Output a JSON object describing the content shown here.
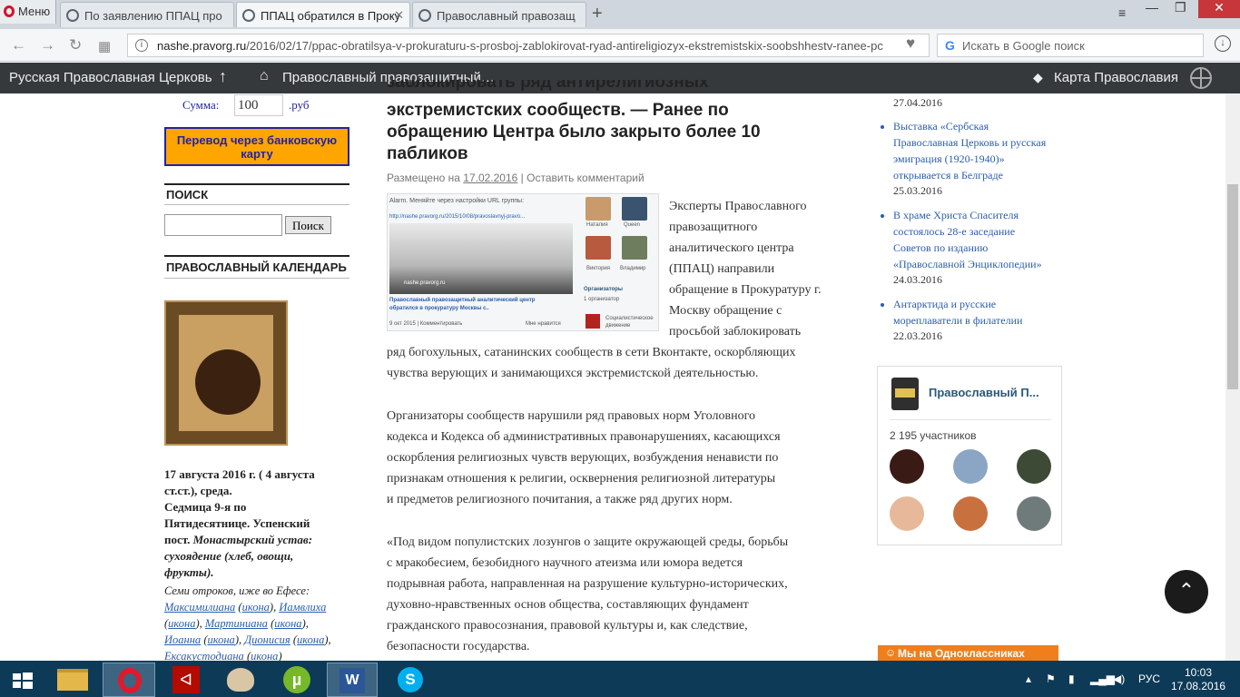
{
  "browser": {
    "menu_label": "Меню",
    "tabs": [
      {
        "title": "По заявлению ППАЦ про",
        "active": false
      },
      {
        "title": "ППАЦ обратился в Проку",
        "active": true
      },
      {
        "title": "Православный правозащ",
        "active": false
      }
    ],
    "url_host": "nashe.pravorg.ru",
    "url_path": "/2016/02/17/ppac-obratilsya-v-prokuraturu-s-prosboj-zablokirovat-ryad-antireligiozyx-ekstremistskix-soobshhestv-ranee-pc",
    "search_placeholder": "Искать в Google поиск"
  },
  "wp_bar": {
    "site1": "Русская Православная Церковь",
    "site2": "Православный правозащитный…",
    "map": "Карта Православия"
  },
  "left": {
    "sum_label": "Сумма:",
    "sum_value": "100",
    "currency": ".руб",
    "donate_button": "Перевод через банковскую карту",
    "search_title": "ПОИСК",
    "search_button": "Поиск",
    "calendar_title": "ПРАВОСЛАВНЫЙ КАЛЕНДАРЬ",
    "date_line1": "17 августа 2016 г. ( 4 августа",
    "date_line2": "ст.ст.), среда.",
    "week_line1": "Седмица 9-я по",
    "week_line2": "Пятидесятнице. Успенский",
    "week_line3": "пост.",
    "rule_inline": "Монастырский устав:",
    "rule_line2": "сухоядение (хлеб, овощи,",
    "rule_line3": "фрукты).",
    "saints_intro": "Семи отроков, иже во Ефесе:",
    "saints": {
      "s1": "Максимилиана",
      "s2": "Иамвлиха",
      "s3": "Мартиниана",
      "s4": "Иоанна",
      "s5": "Дионисия",
      "s6": "Ексакустодиана",
      "icon": "икона"
    }
  },
  "article": {
    "title_l0": "заблокировать ряд антирелигиозных",
    "title_l1": "экстремистских сообществ. — Ранее по",
    "title_l2": "обращению Центра было закрыто более 10",
    "title_l3": "пабликов",
    "posted_prefix": "Размещено на",
    "posted_date": "17.02.2016",
    "separator": "|",
    "comment_link": "Оставить комментарий",
    "screenshot": {
      "alarm": "Alarm. Меняйте через настройки URL группы:",
      "url": "http://nashe.pravorg.ru/2015/10/08/pravoslavnyj-pravo...",
      "site": "nashe.pravorg.ru",
      "caption1": "Православный правозащитный аналитический центр",
      "caption2": "обратился в прокуратуру Москвы с..",
      "footer": "9 окт 2015 | Комментировать",
      "likes": "Мне нравится",
      "names": [
        "Наталия",
        "Queen",
        "Виктория",
        "Владимир"
      ],
      "org_title": "Организаторы",
      "org_count": "1 организатор",
      "org_name1": "Социалистическое",
      "org_name2": "движение"
    },
    "p1_lines": [
      "Эксперты Православного",
      "правозащитного",
      "аналитического центра",
      "(ППАЦ) направили",
      "обращение в Прокуратуру г.",
      "Москву обращение с",
      "просьбой заблокировать"
    ],
    "p1_full1": "ряд богохульных, сатанинских сообществ в сети Вконтакте, оскорбляющих",
    "p1_full2": "чувства верующих и занимающихся экстремистской деятельностью.",
    "p2_lines": [
      "Организаторы сообществ нарушили ряд правовых норм Уголовного",
      "кодекса и Кодекса об административных правонарушениях, касающихся",
      "оскорбления религиозных чувств верующих, возбуждения ненависти по",
      "признакам отношения к религии, осквернения религиозной литературы",
      "и предметов религиозного почитания, а также ряд других норм."
    ],
    "p3_lines": [
      "«Под видом популистских лозунгов о защите окружающей среды, борьбы",
      "с мракобесием, безобидного научного атеизма или юмора ведется",
      "подрывная работа, направленная на разрушение культурно-исторических,",
      "духовно-нравственных основ общества, составляющих фундамент",
      "гражданского правосознания, правовой культуры и, как следствие,",
      "безопасности государства."
    ]
  },
  "right": {
    "top_date": "27.04.2016",
    "news": [
      {
        "lines": [
          "Выставка «Сербская",
          "Православная Церковь и русская",
          "эмиграция (1920-1940)»",
          "открывается в Белграде"
        ],
        "date": "25.03.2016"
      },
      {
        "lines": [
          "В храме Христа Спасителя",
          "состоялось 28-е заседание",
          "Советов по изданию",
          "«Православной Энциклопедии»"
        ],
        "date": "24.03.2016"
      },
      {
        "lines": [
          "Антарктида и русские",
          "мореплаватели в филателии"
        ],
        "date": "22.03.2016"
      }
    ],
    "vk_name": "Православный П...",
    "vk_members": "2 195 участников",
    "ok_label": "Мы на Одноклассниках"
  },
  "taskbar": {
    "lang": "РУС",
    "time": "10:03",
    "date": "17.08.2016"
  },
  "colors": {
    "link": "#2a5db0",
    "donate_bg": "#ffa500",
    "wp_bar": "#36393c",
    "taskbar": "#0d3a57"
  }
}
